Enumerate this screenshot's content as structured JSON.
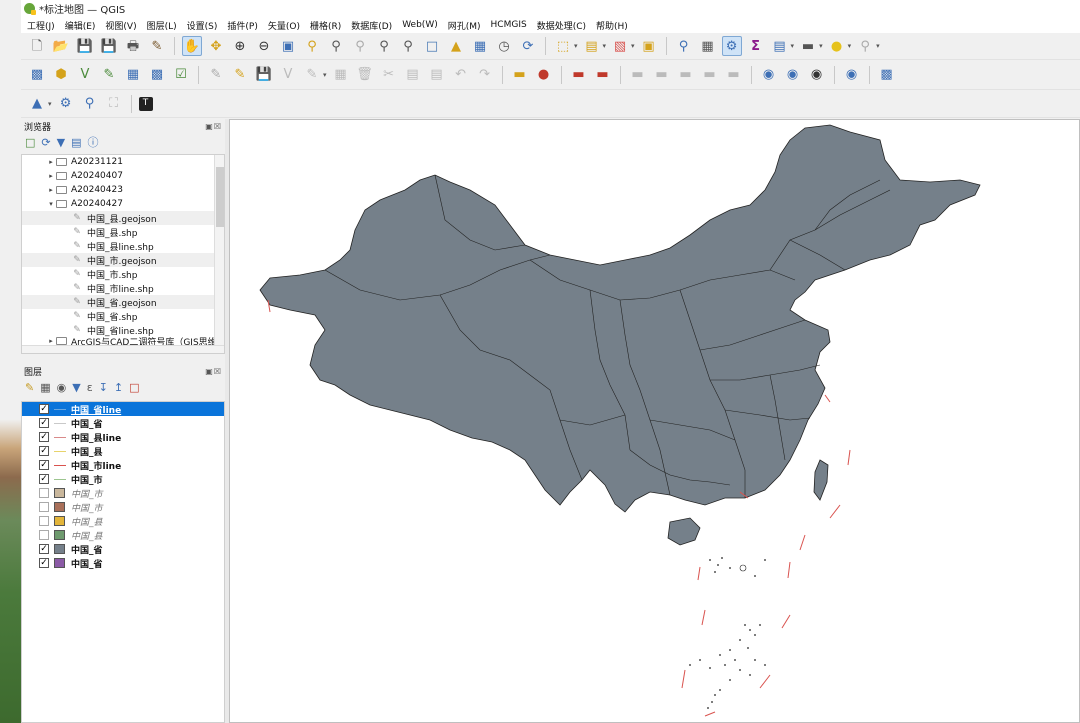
{
  "window": {
    "title": "*标注地图 — QGIS"
  },
  "menu": [
    "工程(J)",
    "编辑(E)",
    "视图(V)",
    "图层(L)",
    "设置(S)",
    "插件(P)",
    "矢量(O)",
    "栅格(R)",
    "数据库(D)",
    "Web(W)",
    "网孔(M)",
    "HCMGIS",
    "数据处理(C)",
    "帮助(H)"
  ],
  "browser": {
    "title": "浏览器",
    "items": [
      {
        "label": "A20231121",
        "type": "folder",
        "expanded": false
      },
      {
        "label": "A20240407",
        "type": "folder",
        "expanded": false
      },
      {
        "label": "A20240423",
        "type": "folder",
        "expanded": false
      },
      {
        "label": "A20240427",
        "type": "folder",
        "expanded": true
      },
      {
        "label": "中国_县.geojson",
        "type": "file"
      },
      {
        "label": "中国_县.shp",
        "type": "file"
      },
      {
        "label": "中国_县line.shp",
        "type": "file"
      },
      {
        "label": "中国_市.geojson",
        "type": "file"
      },
      {
        "label": "中国_市.shp",
        "type": "file"
      },
      {
        "label": "中国_市line.shp",
        "type": "file"
      },
      {
        "label": "中国_省.geojson",
        "type": "file"
      },
      {
        "label": "中国_省.shp",
        "type": "file"
      },
      {
        "label": "中国_省line.shp",
        "type": "file"
      },
      {
        "label": "ArcGIS与CAD二调符号库（GIS思维",
        "type": "folder",
        "expanded": false
      }
    ]
  },
  "layers": {
    "title": "图层",
    "items": [
      {
        "label": "中国_省line",
        "checked": true,
        "symbol": "line",
        "color": "#6aa7e0",
        "selected": true
      },
      {
        "label": "中国_省",
        "checked": true,
        "symbol": "line",
        "color": "#c9c9c9"
      },
      {
        "label": "中国_县line",
        "checked": true,
        "symbol": "line",
        "color": "#d98a8a"
      },
      {
        "label": "中国_县",
        "checked": true,
        "symbol": "line",
        "color": "#e7d36b"
      },
      {
        "label": "中国_市line",
        "checked": true,
        "symbol": "line",
        "color": "#d9534f"
      },
      {
        "label": "中国_市",
        "checked": true,
        "symbol": "line",
        "color": "#9cc58f"
      },
      {
        "label": "中国_市",
        "checked": false,
        "symbol": "fill",
        "color": "#c9b79c"
      },
      {
        "label": "中国_市",
        "checked": false,
        "symbol": "fill",
        "color": "#a9705a"
      },
      {
        "label": "中国_县",
        "checked": false,
        "symbol": "fill",
        "color": "#e3b53a"
      },
      {
        "label": "中国_县",
        "checked": false,
        "symbol": "fill",
        "color": "#6e9a6e"
      },
      {
        "label": "中国_省",
        "checked": true,
        "symbol": "fill",
        "color": "#75808a"
      },
      {
        "label": "中国_省",
        "checked": true,
        "symbol": "fill",
        "color": "#8b5aa6"
      }
    ]
  },
  "map": {
    "fill_color": "#75808a",
    "stroke_color": "#222222",
    "accent_line": "#d9534f"
  },
  "icons": {
    "toolbar1": [
      "new-project-icon",
      "open-folder-icon",
      "save-icon",
      "save-as-icon",
      "print-layout-icon",
      "style-manager-icon",
      "pan-hand-icon",
      "pan-to-selection-icon",
      "zoom-in-icon",
      "zoom-out-icon",
      "zoom-full-icon",
      "zoom-selection-icon",
      "zoom-layer-icon",
      "zoom-native-icon",
      "zoom-last-icon",
      "zoom-next-icon",
      "new-bookmark-icon",
      "show-bookmarks-icon",
      "temporal-icon",
      "refresh-icon",
      "select-feature-icon",
      "attribute-table-icon",
      "deselect-icon",
      "identify-icon",
      "field-calc-icon",
      "statistics-icon",
      "sum-icon",
      "toolbox-icon",
      "measure-icon",
      "annotation-icon",
      "locator-icon"
    ],
    "toolbar2": [
      "data-source-manager-icon",
      "add-vector-icon",
      "add-raster-icon",
      "add-csv-icon",
      "add-wms-icon",
      "add-layer-icon",
      "edit-pencil-icon",
      "toggle-edit-icon",
      "save-edits-icon",
      "digitize-icon",
      "vertex-tool-icon",
      "delete-icon",
      "cut-icon",
      "copy-icon",
      "paste-icon",
      "undo-icon",
      "redo-icon",
      "label-icon",
      "label-tool-icon",
      "diagram-icon",
      "pin-label-icon",
      "show-labels-icon",
      "move-label-icon",
      "rotate-label-icon",
      "change-label-icon",
      "globe-icon",
      "plugin-icon",
      "python-icon",
      "help-icon"
    ],
    "toolbar3": [
      "layer-styling-icon",
      "settings-gear-icon",
      "search-icon",
      "frame-icon",
      "tile-icon"
    ]
  }
}
